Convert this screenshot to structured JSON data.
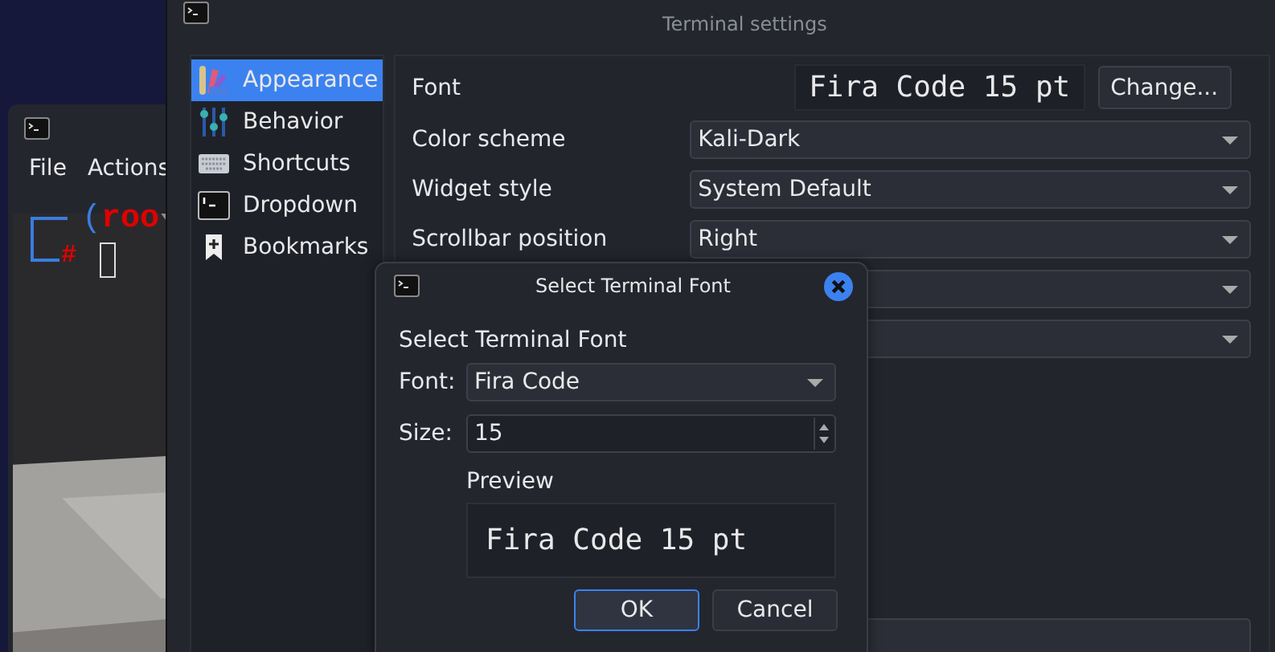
{
  "terminal": {
    "menu": [
      "File",
      "Actions"
    ],
    "prompt": {
      "bracket": "(",
      "user": "roo",
      "symbol": "#"
    }
  },
  "settings": {
    "title": "Terminal settings",
    "sidebar": [
      {
        "label": "Appearance",
        "selected": true
      },
      {
        "label": "Behavior",
        "selected": false
      },
      {
        "label": "Shortcuts",
        "selected": false
      },
      {
        "label": "Dropdown",
        "selected": false
      },
      {
        "label": "Bookmarks",
        "selected": false
      }
    ],
    "font": {
      "label": "Font",
      "preview": "Fira Code 15 pt",
      "button": "Change..."
    },
    "rows": [
      {
        "label": "Color scheme",
        "value": "Kali-Dark"
      },
      {
        "label": "Widget style",
        "value": "System Default"
      },
      {
        "label": "Scrollbar position",
        "value": "Right"
      }
    ]
  },
  "dialog": {
    "title": "Select Terminal Font",
    "heading": "Select Terminal Font",
    "font_label": "Font:",
    "font_value": "Fira Code",
    "size_label": "Size:",
    "size_value": "15",
    "preview_label": "Preview",
    "preview_text": "Fira Code 15 pt",
    "buttons": [
      {
        "label": "OK",
        "default": true
      },
      {
        "label": "Cancel",
        "default": false
      }
    ]
  }
}
